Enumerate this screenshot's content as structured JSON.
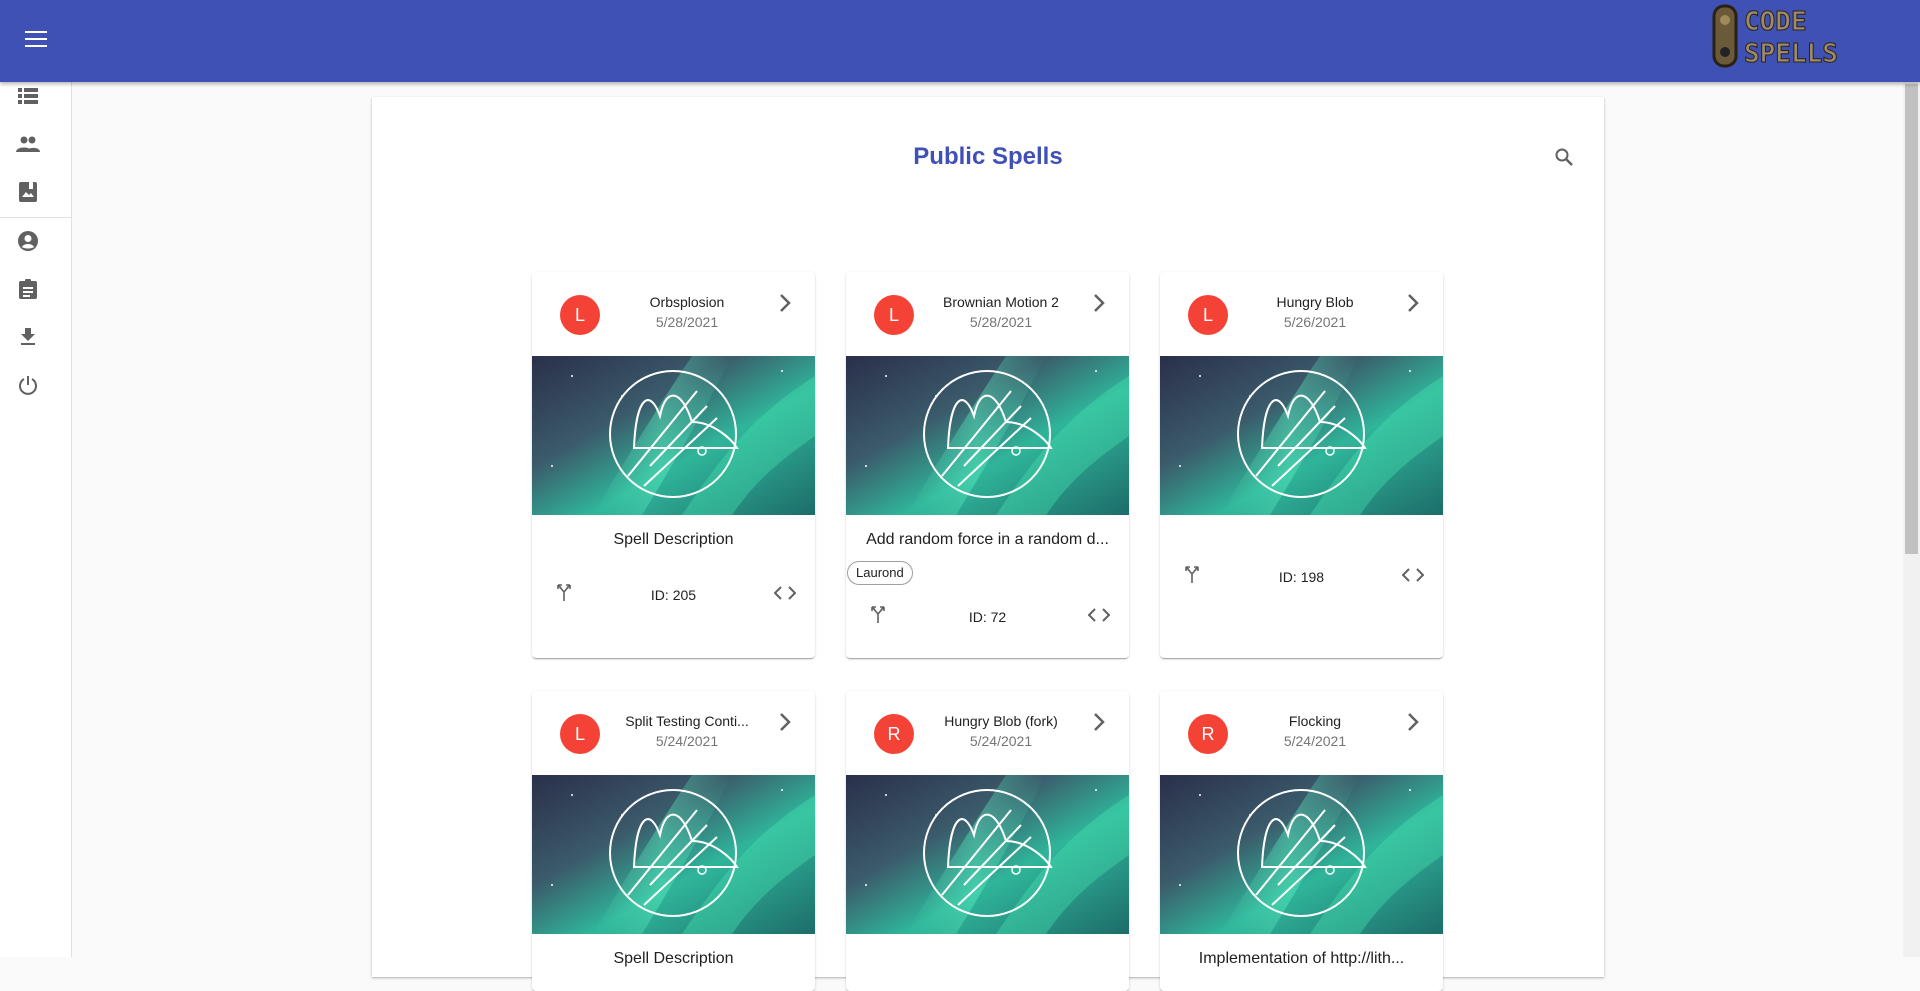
{
  "app": {
    "logo_text": "CODE SPELLS"
  },
  "page": {
    "title": "Public Spells"
  },
  "icons": {
    "menu": "menu-icon",
    "search": "search-icon",
    "sidebar": [
      "list-icon",
      "people-icon",
      "photo-album-icon",
      "account-circle-icon",
      "assignment-icon",
      "download-icon",
      "power-icon"
    ]
  },
  "colors": {
    "primary": "#3f51b5",
    "avatar": "#f44336"
  },
  "cards": [
    {
      "avatar": "L",
      "title": "Orbsplosion",
      "date": "5/28/2021",
      "description": "Spell Description",
      "tag": "",
      "id": "ID: 205"
    },
    {
      "avatar": "L",
      "title": "Brownian Motion 2",
      "date": "5/28/2021",
      "description": "Add random force in a random d...",
      "tag": "Laurond",
      "id": "ID: 72"
    },
    {
      "avatar": "L",
      "title": "Hungry Blob",
      "date": "5/26/2021",
      "description": "",
      "tag": "",
      "id": "ID: 198"
    },
    {
      "avatar": "L",
      "title": "Split Testing Conti...",
      "date": "5/24/2021",
      "description": "Spell Description",
      "tag": "",
      "id": ""
    },
    {
      "avatar": "R",
      "title": "Hungry Blob (fork)",
      "date": "5/24/2021",
      "description": "",
      "tag": "",
      "id": ""
    },
    {
      "avatar": "R",
      "title": "Flocking",
      "date": "5/24/2021",
      "description": "Implementation of http://lith...",
      "tag": "",
      "id": ""
    }
  ]
}
